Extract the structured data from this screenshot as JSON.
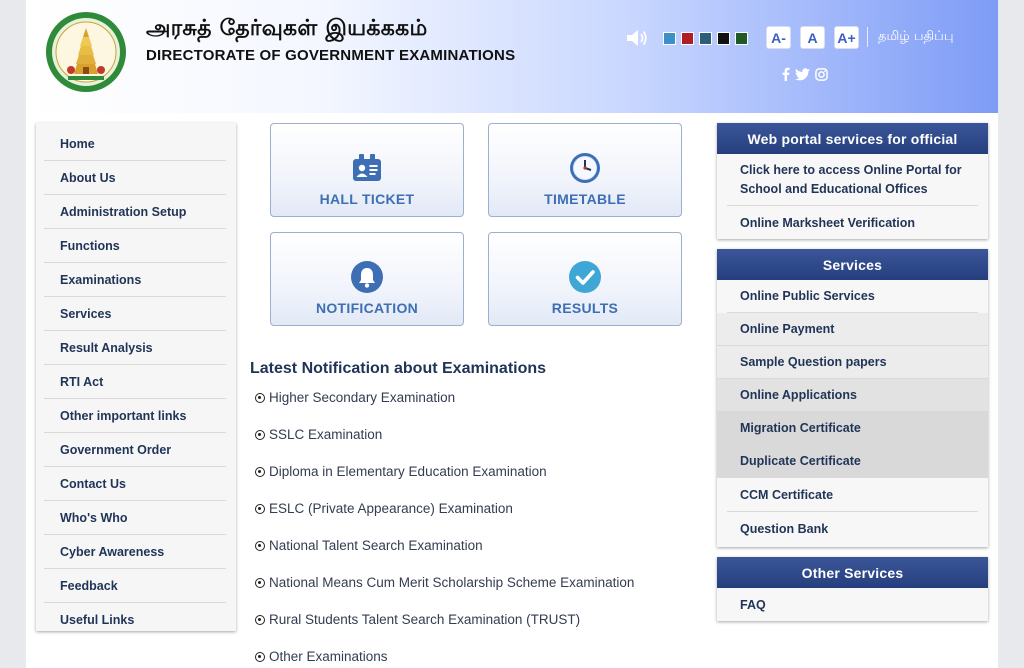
{
  "header": {
    "title_tamil": "அரசுத் தேர்வுகள் இயக்ககம்",
    "title_english": "DIRECTORATE OF GOVERNMENT EXAMINATIONS",
    "font_buttons": [
      "A-",
      "A",
      "A+"
    ],
    "language_link": "தமிழ் பதிப்பு",
    "theme_colors": [
      "#3d8fc9",
      "#b01e23",
      "#2e5f7a",
      "#111111",
      "#1f5a24"
    ],
    "social_icons": [
      "facebook-icon",
      "twitter-icon",
      "instagram-icon"
    ]
  },
  "left_nav": {
    "items": [
      "Home",
      "About Us",
      "Administration Setup",
      "Functions",
      "Examinations",
      "Services",
      "Result Analysis",
      "RTI Act",
      "Other important links",
      "Government Order",
      "Contact Us",
      "Who's Who",
      "Cyber Awareness",
      "Feedback",
      "Useful Links"
    ]
  },
  "tiles": [
    {
      "label": "HALL TICKET",
      "icon": "id-card-icon"
    },
    {
      "label": "TIMETABLE",
      "icon": "clock-icon"
    },
    {
      "label": "NOTIFICATION",
      "icon": "bell-icon"
    },
    {
      "label": "RESULTS",
      "icon": "checkmark-icon"
    }
  ],
  "notifications": {
    "title": "Latest Notification about Examinations",
    "items": [
      "Higher Secondary Examination",
      "SSLC Examination",
      "Diploma in Elementary Education Examination",
      "ESLC (Private Appearance) Examination",
      "National Talent Search Examination",
      "National Means Cum Merit Scholarship Scheme Examination",
      "Rural Students Talent Search Examination (TRUST)",
      "Other Examinations"
    ]
  },
  "web_portal": {
    "title": "Web portal services for official",
    "items": [
      "Click here to access Online Portal for School and Educational Offices",
      "Online Marksheet Verification"
    ]
  },
  "services": {
    "title": "Services",
    "items": [
      "Online Public Services",
      "Online Payment",
      "Sample Question papers",
      "Online Applications",
      "Migration Certificate",
      "Duplicate Certificate",
      "CCM Certificate",
      "Question Bank"
    ]
  },
  "other_services": {
    "title": "Other Services",
    "items": [
      "FAQ"
    ]
  }
}
